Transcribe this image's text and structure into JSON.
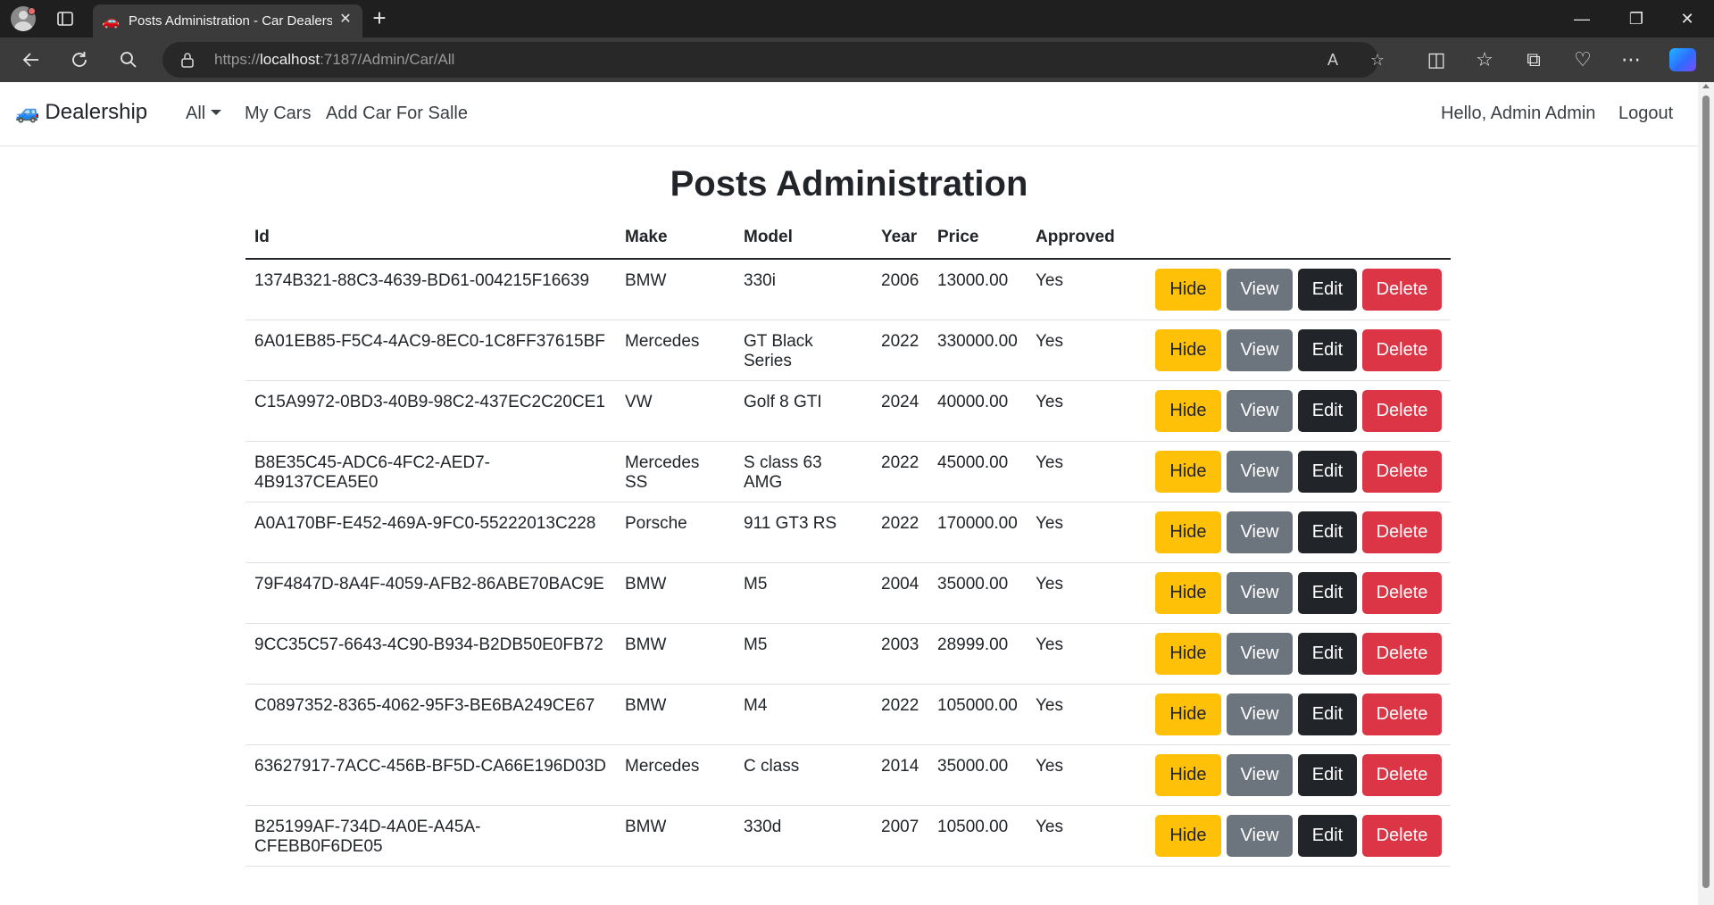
{
  "browser": {
    "tab_title": "Posts Administration - Car Dealership",
    "url_scheme": "https://",
    "url_host": "localhost",
    "url_rest": ":7187/Admin/Car/All"
  },
  "navbar": {
    "brand": "Dealership",
    "nav_all": "All",
    "nav_my_cars": "My Cars",
    "nav_add_car": "Add Car For Salle",
    "greeting": "Hello, Admin Admin",
    "logout": "Logout"
  },
  "page": {
    "title": "Posts Administration"
  },
  "table": {
    "headers": [
      "Id",
      "Make",
      "Model",
      "Year",
      "Price",
      "Approved"
    ],
    "rows": [
      {
        "id": "1374B321-88C3-4639-BD61-004215F16639",
        "make": "BMW",
        "model": "330i",
        "year": "2006",
        "price": "13000.00",
        "approved": "Yes"
      },
      {
        "id": "6A01EB85-F5C4-4AC9-8EC0-1C8FF37615BF",
        "make": "Mercedes",
        "model": "GT Black Series",
        "year": "2022",
        "price": "330000.00",
        "approved": "Yes"
      },
      {
        "id": "C15A9972-0BD3-40B9-98C2-437EC2C20CE1",
        "make": "VW",
        "model": "Golf 8 GTI",
        "year": "2024",
        "price": "40000.00",
        "approved": "Yes"
      },
      {
        "id": "B8E35C45-ADC6-4FC2-AED7-4B9137CEA5E0",
        "make": "Mercedes SS",
        "model": "S class 63 AMG",
        "year": "2022",
        "price": "45000.00",
        "approved": "Yes"
      },
      {
        "id": "A0A170BF-E452-469A-9FC0-55222013C228",
        "make": "Porsche",
        "model": "911 GT3 RS",
        "year": "2022",
        "price": "170000.00",
        "approved": "Yes"
      },
      {
        "id": "79F4847D-8A4F-4059-AFB2-86ABE70BAC9E",
        "make": "BMW",
        "model": "M5",
        "year": "2004",
        "price": "35000.00",
        "approved": "Yes"
      },
      {
        "id": "9CC35C57-6643-4C90-B934-B2DB50E0FB72",
        "make": "BMW",
        "model": "M5",
        "year": "2003",
        "price": "28999.00",
        "approved": "Yes"
      },
      {
        "id": "C0897352-8365-4062-95F3-BE6BA249CE67",
        "make": "BMW",
        "model": "M4",
        "year": "2022",
        "price": "105000.00",
        "approved": "Yes"
      },
      {
        "id": "63627917-7ACC-456B-BF5D-CA66E196D03D",
        "make": "Mercedes",
        "model": "C class",
        "year": "2014",
        "price": "35000.00",
        "approved": "Yes"
      },
      {
        "id": "B25199AF-734D-4A0E-A45A-CFEBB0F6DE05",
        "make": "BMW",
        "model": "330d",
        "year": "2007",
        "price": "10500.00",
        "approved": "Yes"
      }
    ],
    "actions": {
      "hide": "Hide",
      "view": "View",
      "edit": "Edit",
      "delete": "Delete"
    }
  },
  "colors": {
    "hide": "#ffc107",
    "view": "#6c757d",
    "edit": "#212529",
    "delete": "#dc3545"
  }
}
